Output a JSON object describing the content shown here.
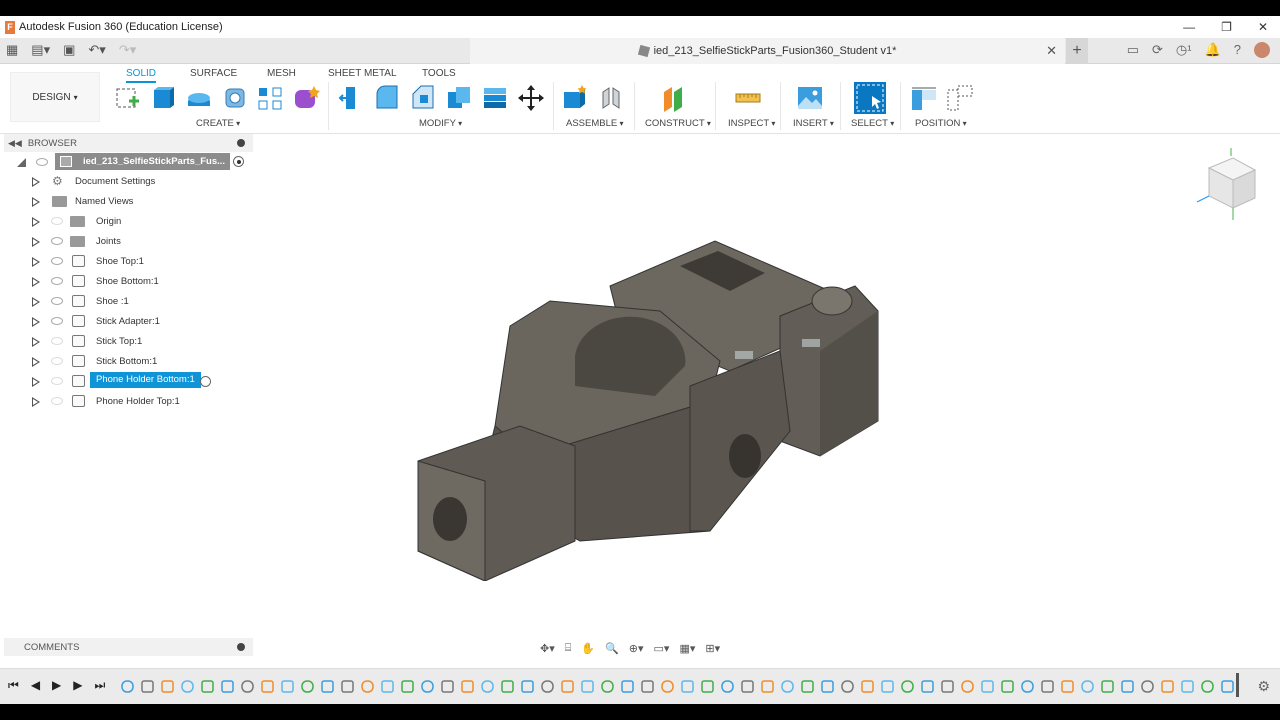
{
  "window": {
    "title": "Autodesk Fusion 360 (Education License)",
    "app_icon_letter": "F"
  },
  "doc_tab": {
    "title": "ied_213_SelfieStickParts_Fusion360_Student v1*"
  },
  "toolbar": {
    "workspace_button": "DESIGN",
    "tabs": [
      "SOLID",
      "SURFACE",
      "MESH",
      "SHEET METAL",
      "TOOLS"
    ],
    "active_tab": "SOLID",
    "groups": [
      "CREATE",
      "MODIFY",
      "ASSEMBLE",
      "CONSTRUCT",
      "INSPECT",
      "INSERT",
      "SELECT",
      "POSITION"
    ]
  },
  "browser": {
    "header": "BROWSER",
    "root": "ied_213_SelfieStickParts_Fus...",
    "items": [
      {
        "label": "Document Settings",
        "icon": "gear-icon",
        "eye": false
      },
      {
        "label": "Named Views",
        "icon": "folder-icon",
        "eye": false
      },
      {
        "label": "Origin",
        "icon": "folder-icon",
        "eye": "dim"
      },
      {
        "label": "Joints",
        "icon": "folder-icon",
        "eye": true
      },
      {
        "label": "Shoe Top:1",
        "icon": "component-icon",
        "eye": true
      },
      {
        "label": "Shoe Bottom:1",
        "icon": "component-icon",
        "eye": true
      },
      {
        "label": "Shoe :1",
        "icon": "component-icon",
        "eye": true
      },
      {
        "label": "Stick Adapter:1",
        "icon": "component-icon",
        "eye": true
      },
      {
        "label": "Stick Top:1",
        "icon": "component-icon",
        "eye": "dim"
      },
      {
        "label": "Stick Bottom:1",
        "icon": "component-icon",
        "eye": "dim"
      },
      {
        "label": "Phone Holder Bottom:1",
        "icon": "component-icon",
        "eye": "dim",
        "selected": true
      },
      {
        "label": "Phone Holder Top:1",
        "icon": "component-icon",
        "eye": "dim"
      }
    ]
  },
  "comments": {
    "header": "COMMENTS"
  },
  "colors": {
    "accent": "#0696d7",
    "selection": "#1094d8",
    "model": "#5e5952"
  }
}
